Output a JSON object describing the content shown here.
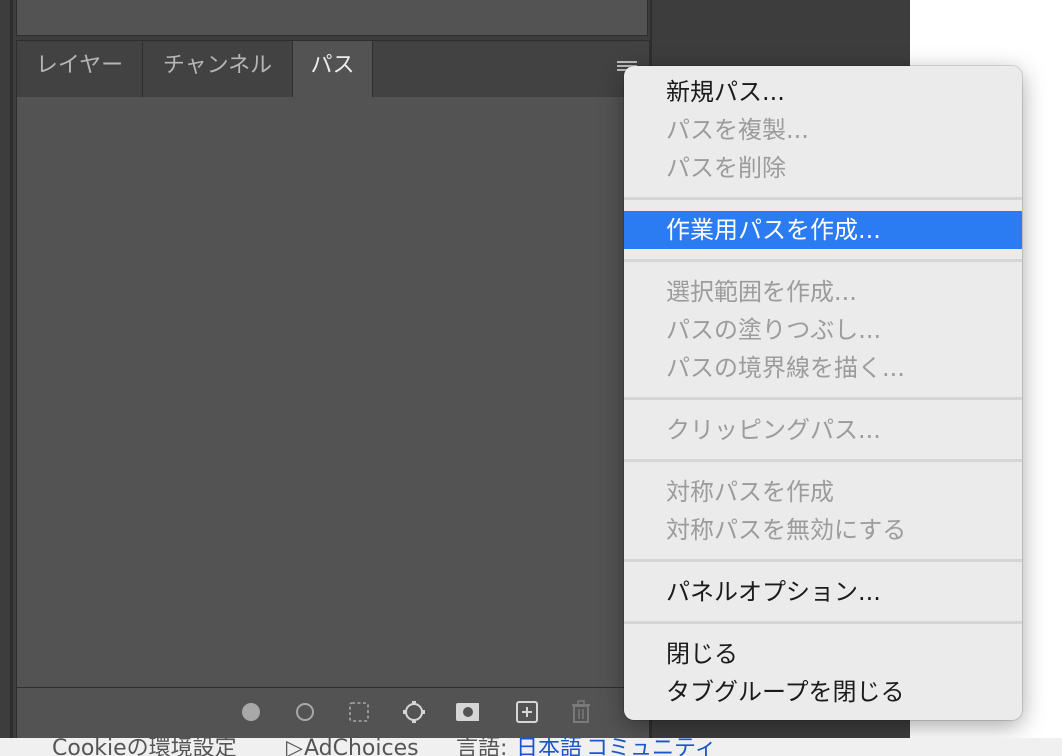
{
  "panel": {
    "tabs": [
      {
        "label": "レイヤー",
        "active": false
      },
      {
        "label": "チャンネル",
        "active": false
      },
      {
        "label": "パス",
        "active": true
      }
    ],
    "menu_icon": "hamburger-menu-icon",
    "footer_icons": [
      "fill-path-icon",
      "stroke-path-icon",
      "load-selection-icon",
      "make-work-path-icon",
      "add-mask-icon",
      "new-path-icon",
      "trash-icon"
    ]
  },
  "menu": {
    "items": [
      {
        "label": "新規パス...",
        "enabled": true
      },
      {
        "label": "パスを複製...",
        "enabled": false
      },
      {
        "label": "パスを削除",
        "enabled": false
      },
      {
        "label": "作業用パスを作成...",
        "enabled": true,
        "highlighted": true
      },
      {
        "label": "選択範囲を作成...",
        "enabled": false
      },
      {
        "label": "パスの塗りつぶし...",
        "enabled": false
      },
      {
        "label": "パスの境界線を描く...",
        "enabled": false
      },
      {
        "label": "クリッピングパス...",
        "enabled": false
      },
      {
        "label": "対称パスを作成",
        "enabled": false
      },
      {
        "label": "対称パスを無効にする",
        "enabled": false
      },
      {
        "label": "パネルオプション...",
        "enabled": true
      },
      {
        "label": "閉じる",
        "enabled": true
      },
      {
        "label": "タブグループを閉じる",
        "enabled": true
      }
    ],
    "highlight_color": "#2b7bf2"
  },
  "page_footer": {
    "cookie": "Cookieの環境設定",
    "adchoices": "AdChoices",
    "language_label": "言語:",
    "language_value": "日本語",
    "community": "コミュニティ"
  }
}
